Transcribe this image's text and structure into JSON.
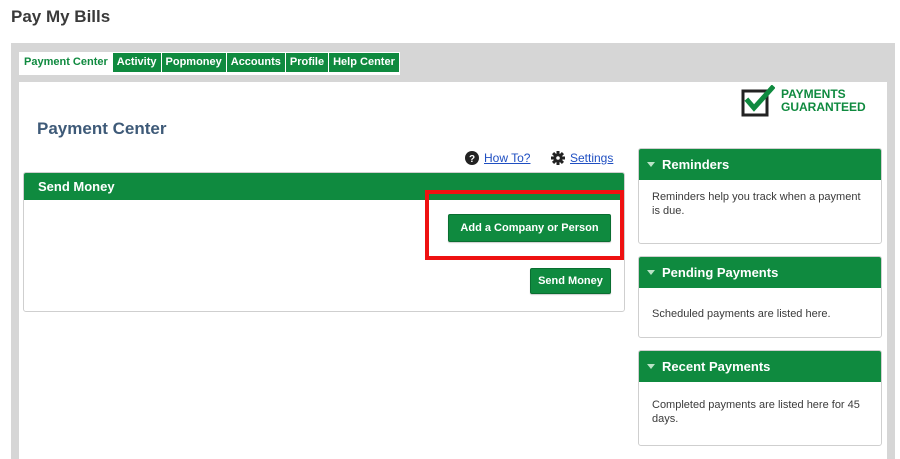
{
  "page": {
    "title": "Pay My Bills"
  },
  "tabs": [
    {
      "label": "Payment Center",
      "active": true
    },
    {
      "label": "Activity"
    },
    {
      "label": "Popmoney"
    },
    {
      "label": "Accounts"
    },
    {
      "label": "Profile"
    },
    {
      "label": "Help Center"
    }
  ],
  "guarantee": {
    "line1": "PAYMENTS",
    "line2": "GUARANTEED"
  },
  "main": {
    "heading": "Payment Center",
    "how_to_label": "How To?",
    "settings_label": "Settings",
    "send_money": {
      "title": "Send Money",
      "add_button": "Add a Company or Person",
      "send_button": "Send Money"
    }
  },
  "sidebar": {
    "reminders": {
      "title": "Reminders",
      "text": "Reminders help you track when a payment is due."
    },
    "pending": {
      "title": "Pending Payments",
      "text": "Scheduled payments are listed here."
    },
    "recent": {
      "title": "Recent Payments",
      "text": "Completed payments are listed here for 45 days."
    }
  },
  "colors": {
    "brand_green": "#0f8a3f",
    "highlight_red": "#ee1111",
    "heading_blue": "#3e5a78",
    "link_blue": "#1f4fc2"
  },
  "icons": {
    "how_to": "question-circle-icon",
    "settings": "gear-icon",
    "guarantee": "checkbox-icon",
    "section_toggle": "caret-down-icon"
  }
}
